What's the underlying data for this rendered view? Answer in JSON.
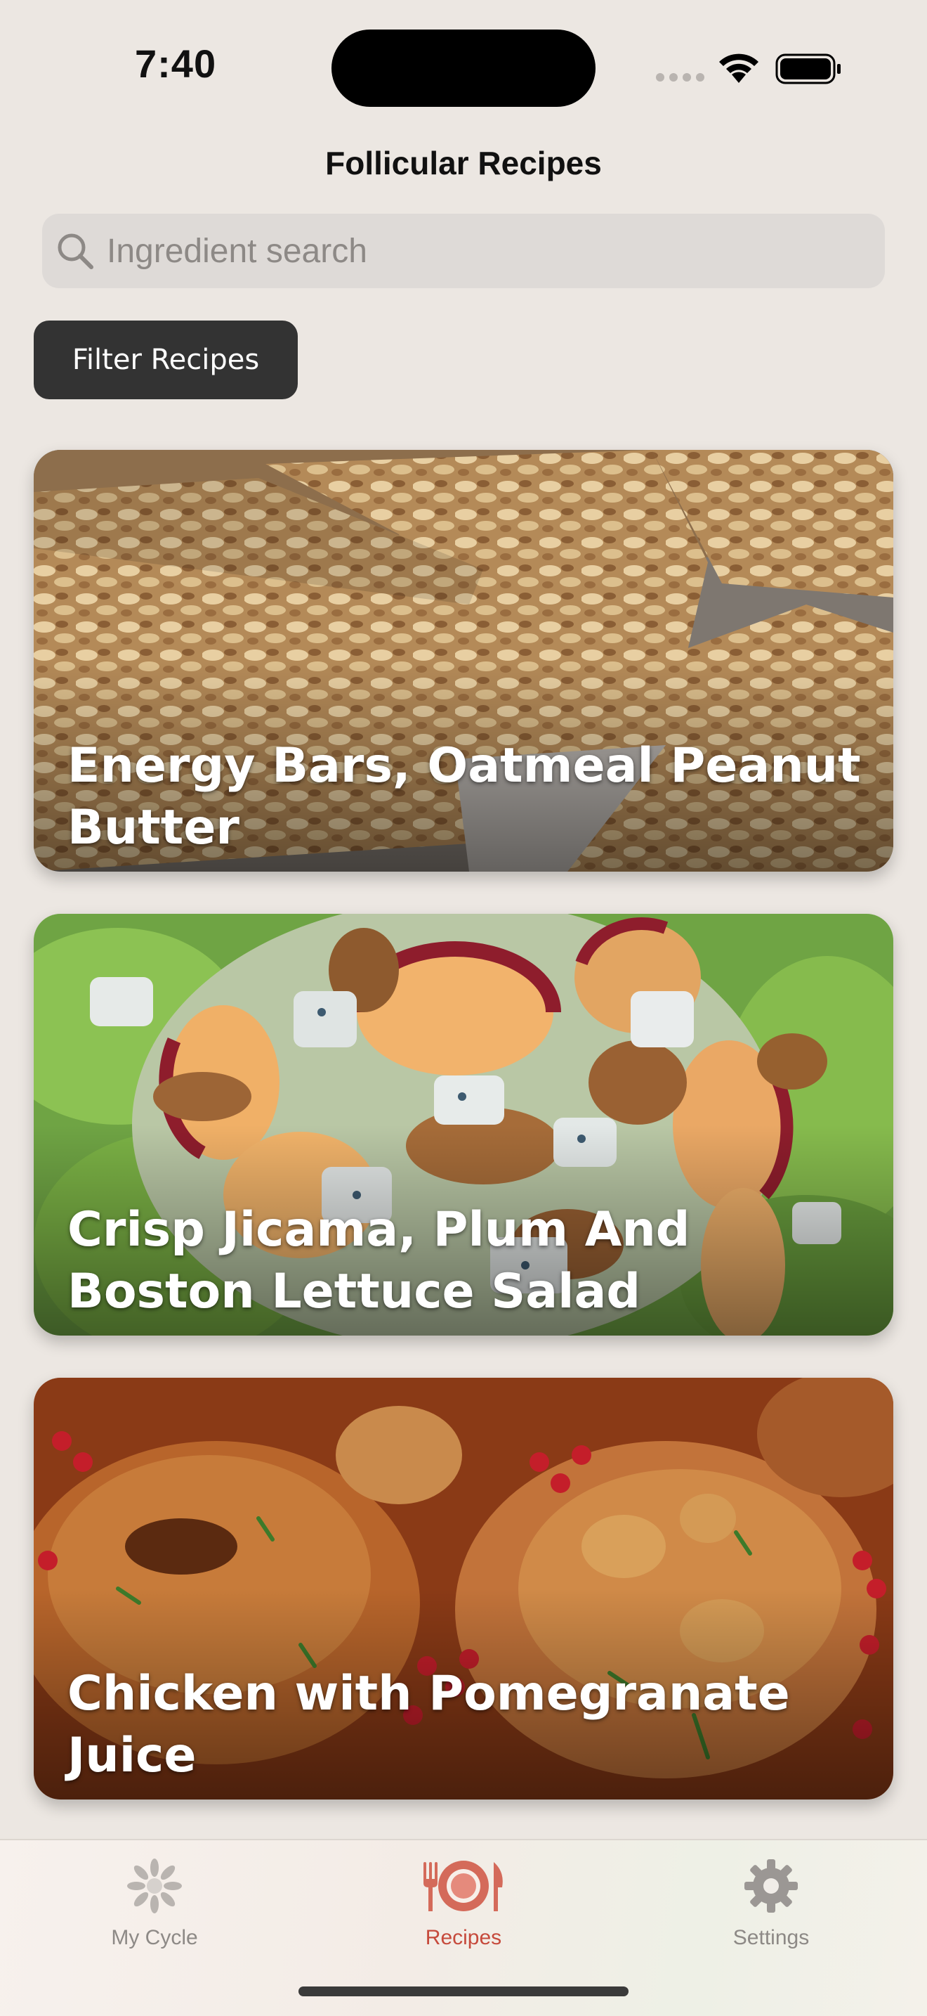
{
  "status_bar": {
    "time": "7:40"
  },
  "header": {
    "title": "Follicular Recipes"
  },
  "search": {
    "placeholder": "Ingredient search",
    "value": ""
  },
  "filter": {
    "label": "Filter Recipes"
  },
  "recipes": [
    {
      "title": "Energy Bars, Oatmeal Peanut Butter"
    },
    {
      "title": "Crisp Jicama, Plum And Boston Lettuce Salad"
    },
    {
      "title": "Chicken with Pomegranate Juice"
    }
  ],
  "tab_bar": {
    "tabs": [
      {
        "label": "My Cycle",
        "icon": "flower-icon",
        "active": false
      },
      {
        "label": "Recipes",
        "icon": "fork-plate-knife-icon",
        "active": true
      },
      {
        "label": "Settings",
        "icon": "gear-icon",
        "active": false
      }
    ]
  },
  "colors": {
    "accent": "#c64a3c",
    "button_dark": "#333333",
    "background": "#ece7e2"
  }
}
